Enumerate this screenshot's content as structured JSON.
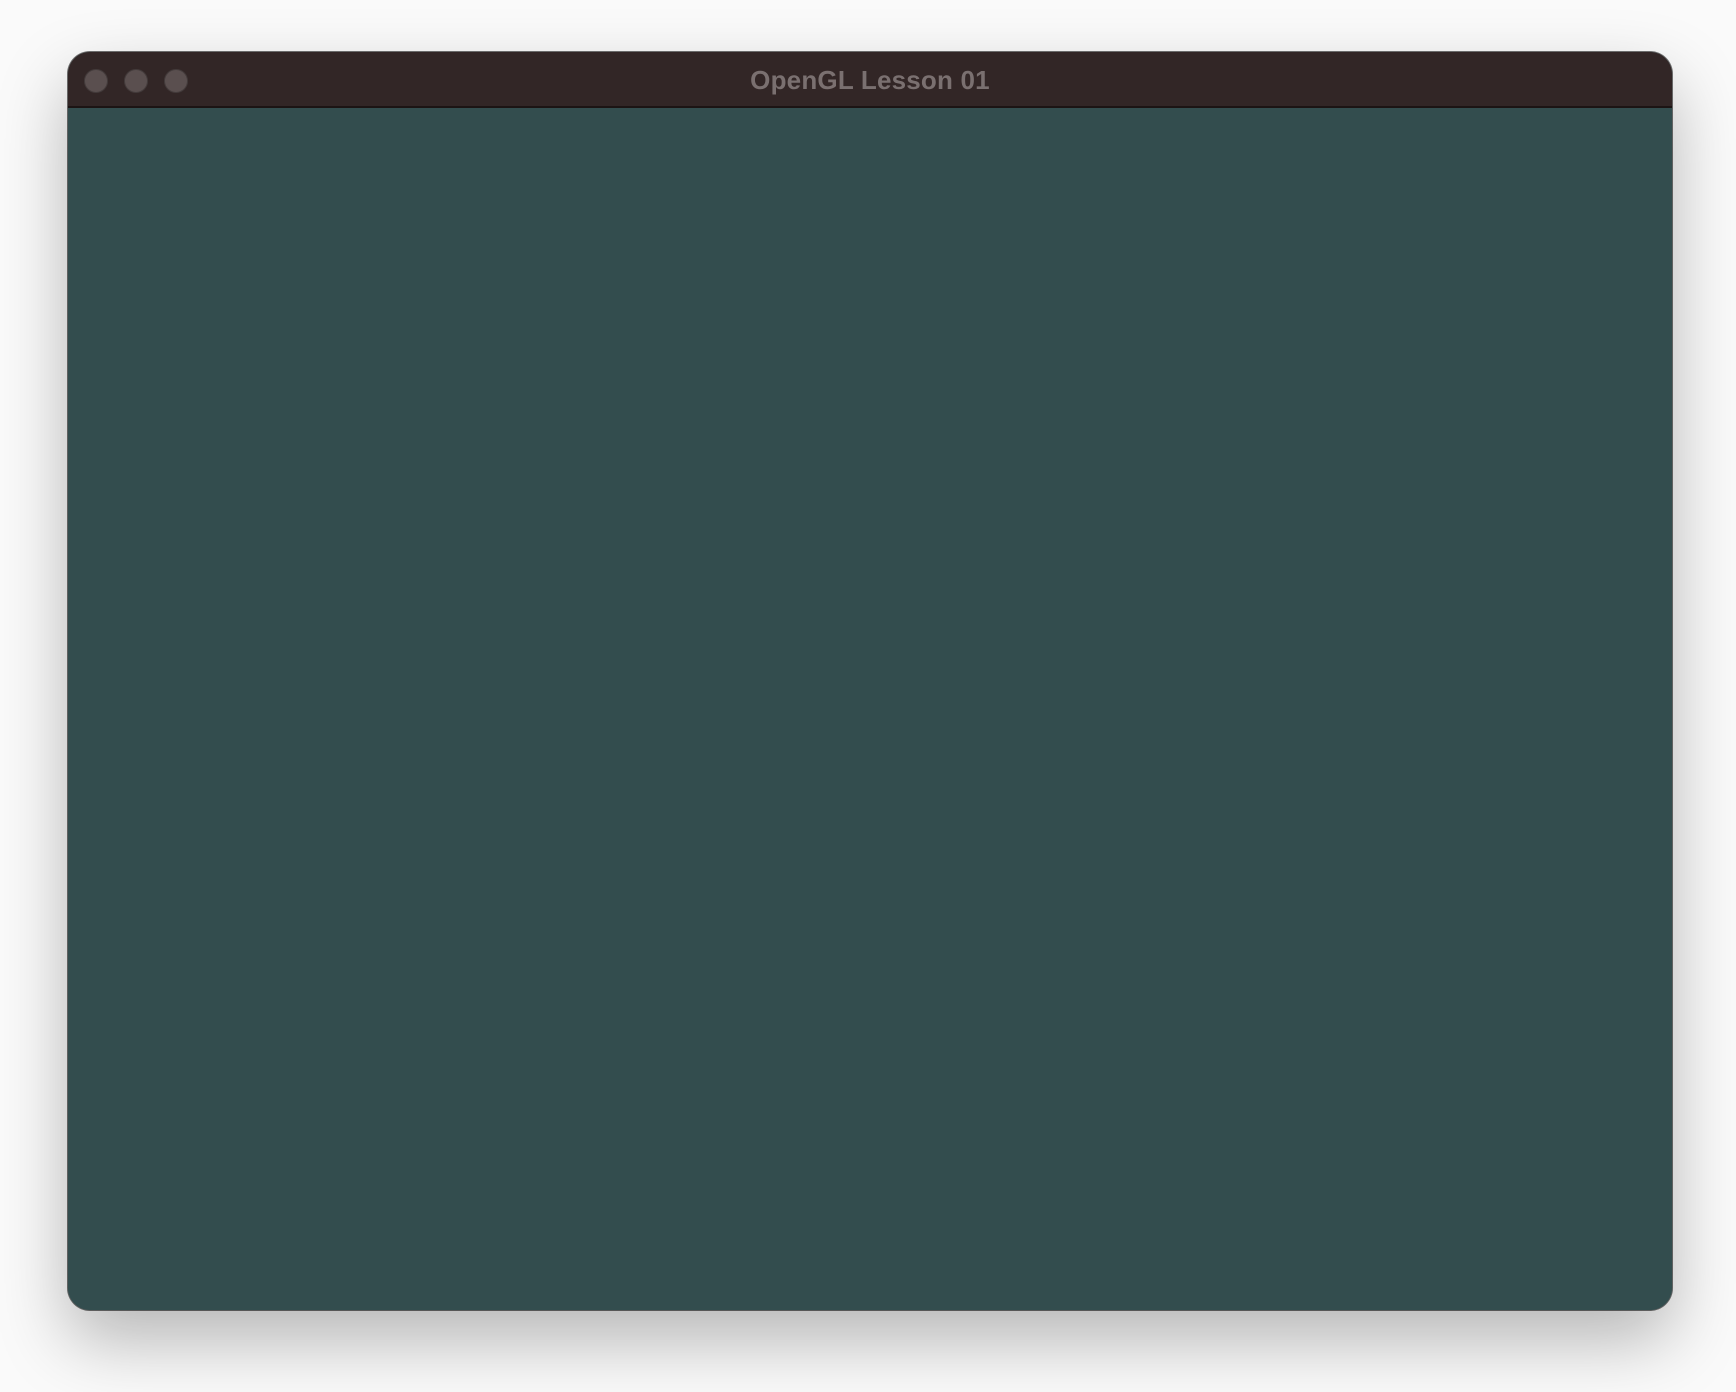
{
  "window": {
    "title": "OpenGL Lesson 01",
    "buttons": [
      {
        "name": "close",
        "icon": "traffic-light-close"
      },
      {
        "name": "minimize",
        "icon": "traffic-light-minimize"
      },
      {
        "name": "zoom",
        "icon": "traffic-light-zoom"
      }
    ]
  },
  "colors": {
    "titlebar": "#322626",
    "title_text": "#7a7070",
    "traffic_light_inactive": "#5a4f4f",
    "clear_color": "#334d4e",
    "desktop": "#fafafa"
  }
}
